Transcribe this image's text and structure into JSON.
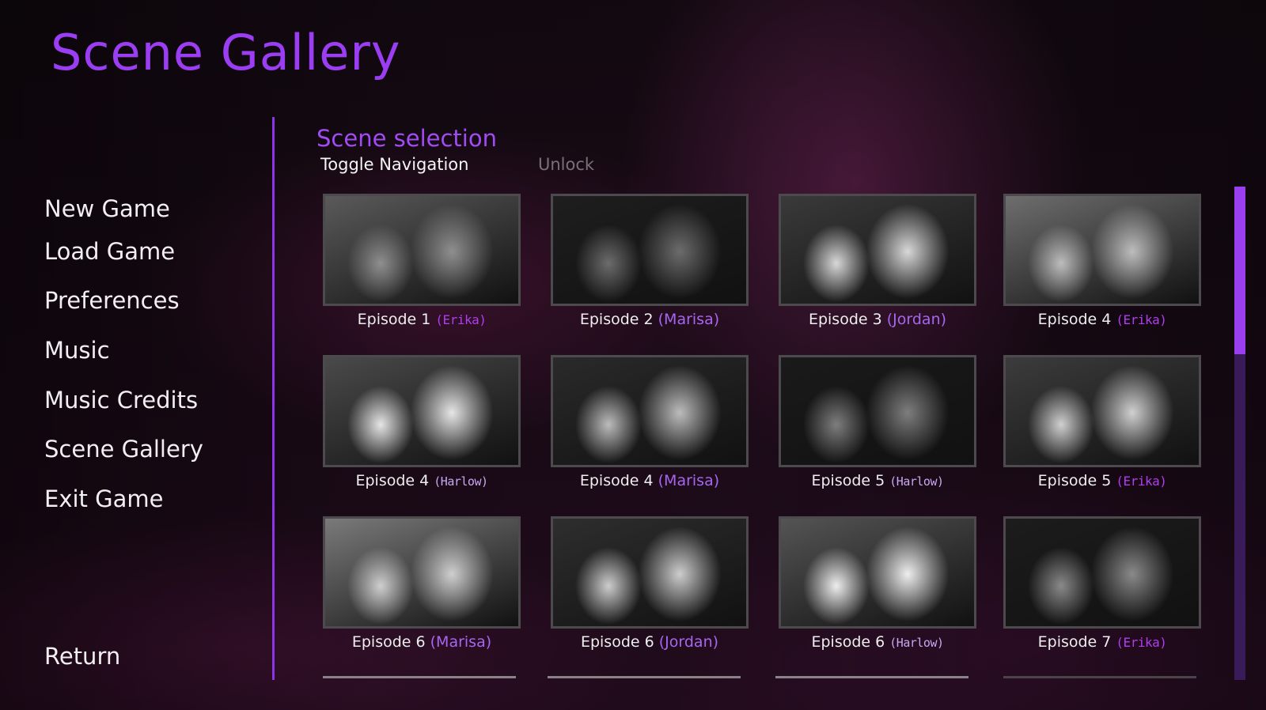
{
  "title": "Scene Gallery",
  "nav": {
    "items": [
      {
        "id": "new-game",
        "label": "New Game"
      },
      {
        "id": "load-game",
        "label": "Load Game"
      },
      {
        "id": "preferences",
        "label": "Preferences"
      },
      {
        "id": "music",
        "label": "Music"
      },
      {
        "id": "music-credits",
        "label": "Music Credits"
      },
      {
        "id": "scene-gallery",
        "label": "Scene Gallery"
      },
      {
        "id": "exit-game",
        "label": "Exit Game"
      }
    ],
    "return_label": "Return"
  },
  "gallery": {
    "section_title": "Scene selection",
    "toggle_navigation_label": "Toggle Navigation",
    "unlock_label": "Unlock",
    "scenes": [
      {
        "episode": "Episode 1",
        "character": "(Erika)",
        "style": "hand"
      },
      {
        "episode": "Episode 2",
        "character": "(Marisa)",
        "style": "plain"
      },
      {
        "episode": "Episode 3",
        "character": "(Jordan)",
        "style": "plain"
      },
      {
        "episode": "Episode 4",
        "character": "(Erika)",
        "style": "hand"
      },
      {
        "episode": "Episode 4",
        "character": "(Harlow)",
        "style": "harlow"
      },
      {
        "episode": "Episode 4",
        "character": "(Marisa)",
        "style": "plain"
      },
      {
        "episode": "Episode 5",
        "character": "(Harlow)",
        "style": "harlow"
      },
      {
        "episode": "Episode 5",
        "character": "(Erika)",
        "style": "hand"
      },
      {
        "episode": "Episode 6",
        "character": "(Marisa)",
        "style": "plain"
      },
      {
        "episode": "Episode 6",
        "character": "(Jordan)",
        "style": "plain"
      },
      {
        "episode": "Episode 6",
        "character": "(Harlow)",
        "style": "harlow"
      },
      {
        "episode": "Episode 7",
        "character": "(Erika)",
        "style": "hand"
      }
    ]
  },
  "scrollbar": {
    "position_fraction": 0.0,
    "visible_fraction": 0.34
  },
  "colors": {
    "accent": "#9b3df2",
    "menu_text": "#f2eef2",
    "disabled_text": "#7a7078",
    "character_name": "#a866f0"
  }
}
